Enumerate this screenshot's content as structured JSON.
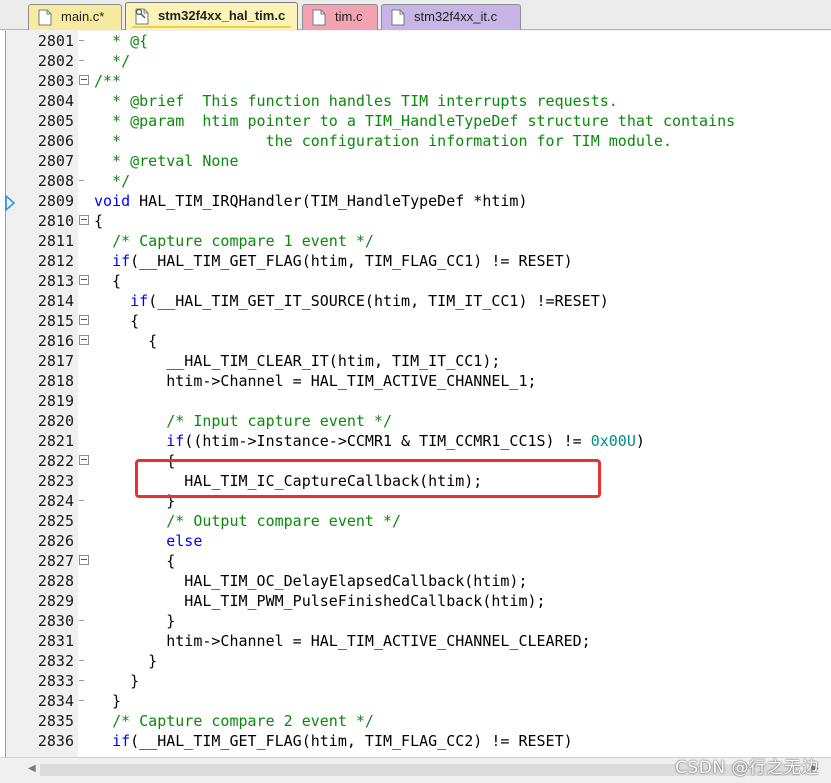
{
  "tabs": [
    {
      "label": "main.c*",
      "active": false,
      "color": "#f6eba0"
    },
    {
      "label": "stm32f4xx_hal_tim.c",
      "active": true,
      "color": "#fbf3b7"
    },
    {
      "label": "tim.c",
      "active": false,
      "color": "#f3a2b3"
    },
    {
      "label": "stm32f4xx_it.c",
      "active": false,
      "color": "#c7b5e8"
    }
  ],
  "editor": {
    "current_line": "2809",
    "highlighted_line": "2823",
    "lines": [
      {
        "n": "2801",
        "fold": "tick",
        "segments": [
          {
            "t": "  * @{",
            "c": "cm"
          }
        ]
      },
      {
        "n": "2802",
        "fold": "tick",
        "segments": [
          {
            "t": "  */",
            "c": "cm"
          }
        ]
      },
      {
        "n": "2803",
        "fold": "box",
        "segments": [
          {
            "t": "/**",
            "c": "cm"
          }
        ]
      },
      {
        "n": "2804",
        "fold": "",
        "segments": [
          {
            "t": "  * @brief  This function handles TIM interrupts requests.",
            "c": "cm"
          }
        ]
      },
      {
        "n": "2805",
        "fold": "",
        "segments": [
          {
            "t": "  * @param  htim pointer to a TIM_HandleTypeDef structure that contains",
            "c": "cm"
          }
        ]
      },
      {
        "n": "2806",
        "fold": "",
        "segments": [
          {
            "t": "  *                the configuration information for TIM module.",
            "c": "cm"
          }
        ]
      },
      {
        "n": "2807",
        "fold": "",
        "segments": [
          {
            "t": "  * @retval None",
            "c": "cm"
          }
        ]
      },
      {
        "n": "2808",
        "fold": "tick",
        "segments": [
          {
            "t": "  */",
            "c": "cm"
          }
        ]
      },
      {
        "n": "2809",
        "fold": "",
        "segments": [
          {
            "t": "void",
            "c": "kw"
          },
          {
            "t": " HAL_TIM_IRQHandler(TIM_HandleTypeDef *htim)",
            "c": ""
          }
        ]
      },
      {
        "n": "2810",
        "fold": "box",
        "segments": [
          {
            "t": "{",
            "c": ""
          }
        ]
      },
      {
        "n": "2811",
        "fold": "",
        "segments": [
          {
            "t": "  ",
            "c": ""
          },
          {
            "t": "/* Capture compare 1 event */",
            "c": "cm"
          }
        ]
      },
      {
        "n": "2812",
        "fold": "",
        "segments": [
          {
            "t": "  ",
            "c": ""
          },
          {
            "t": "if",
            "c": "kw"
          },
          {
            "t": "(__HAL_TIM_GET_FLAG(htim, TIM_FLAG_CC1) != RESET)",
            "c": ""
          }
        ]
      },
      {
        "n": "2813",
        "fold": "box",
        "segments": [
          {
            "t": "  {",
            "c": ""
          }
        ]
      },
      {
        "n": "2814",
        "fold": "",
        "segments": [
          {
            "t": "    ",
            "c": ""
          },
          {
            "t": "if",
            "c": "kw"
          },
          {
            "t": "(__HAL_TIM_GET_IT_SOURCE(htim, TIM_IT_CC1) !=RESET)",
            "c": ""
          }
        ]
      },
      {
        "n": "2815",
        "fold": "box",
        "segments": [
          {
            "t": "    {",
            "c": ""
          }
        ]
      },
      {
        "n": "2816",
        "fold": "box",
        "segments": [
          {
            "t": "      {",
            "c": ""
          }
        ]
      },
      {
        "n": "2817",
        "fold": "",
        "segments": [
          {
            "t": "        __HAL_TIM_CLEAR_IT(htim, TIM_IT_CC1);",
            "c": ""
          }
        ]
      },
      {
        "n": "2818",
        "fold": "",
        "segments": [
          {
            "t": "        htim->Channel = HAL_TIM_ACTIVE_CHANNEL_1;",
            "c": ""
          }
        ]
      },
      {
        "n": "2819",
        "fold": "",
        "segments": [
          {
            "t": "",
            "c": ""
          }
        ]
      },
      {
        "n": "2820",
        "fold": "",
        "segments": [
          {
            "t": "        ",
            "c": ""
          },
          {
            "t": "/* Input capture event */",
            "c": "cm"
          }
        ]
      },
      {
        "n": "2821",
        "fold": "",
        "segments": [
          {
            "t": "        ",
            "c": ""
          },
          {
            "t": "if",
            "c": "kw"
          },
          {
            "t": "((htim->Instance->CCMR1 & TIM_CCMR1_CC1S) != ",
            "c": ""
          },
          {
            "t": "0x00U",
            "c": "num"
          },
          {
            "t": ")",
            "c": ""
          }
        ]
      },
      {
        "n": "2822",
        "fold": "box",
        "segments": [
          {
            "t": "        {",
            "c": ""
          }
        ]
      },
      {
        "n": "2823",
        "fold": "",
        "segments": [
          {
            "t": "          HAL_TIM_IC_CaptureCallback(htim);",
            "c": ""
          }
        ]
      },
      {
        "n": "2824",
        "fold": "tick",
        "segments": [
          {
            "t": "        }",
            "c": ""
          }
        ]
      },
      {
        "n": "2825",
        "fold": "",
        "segments": [
          {
            "t": "        ",
            "c": ""
          },
          {
            "t": "/* Output compare event */",
            "c": "cm"
          }
        ]
      },
      {
        "n": "2826",
        "fold": "",
        "segments": [
          {
            "t": "        ",
            "c": ""
          },
          {
            "t": "else",
            "c": "kw"
          }
        ]
      },
      {
        "n": "2827",
        "fold": "box",
        "segments": [
          {
            "t": "        {",
            "c": ""
          }
        ]
      },
      {
        "n": "2828",
        "fold": "",
        "segments": [
          {
            "t": "          HAL_TIM_OC_DelayElapsedCallback(htim);",
            "c": ""
          }
        ]
      },
      {
        "n": "2829",
        "fold": "",
        "segments": [
          {
            "t": "          HAL_TIM_PWM_PulseFinishedCallback(htim);",
            "c": ""
          }
        ]
      },
      {
        "n": "2830",
        "fold": "tick",
        "segments": [
          {
            "t": "        }",
            "c": ""
          }
        ]
      },
      {
        "n": "2831",
        "fold": "",
        "segments": [
          {
            "t": "        htim->Channel = HAL_TIM_ACTIVE_CHANNEL_CLEARED;",
            "c": ""
          }
        ]
      },
      {
        "n": "2832",
        "fold": "tick",
        "segments": [
          {
            "t": "      }",
            "c": ""
          }
        ]
      },
      {
        "n": "2833",
        "fold": "tick",
        "segments": [
          {
            "t": "    }",
            "c": ""
          }
        ]
      },
      {
        "n": "2834",
        "fold": "tick",
        "segments": [
          {
            "t": "  }",
            "c": ""
          }
        ]
      },
      {
        "n": "2835",
        "fold": "",
        "segments": [
          {
            "t": "  ",
            "c": ""
          },
          {
            "t": "/* Capture compare 2 event */",
            "c": "cm"
          }
        ]
      },
      {
        "n": "2836",
        "fold": "",
        "segments": [
          {
            "t": "  ",
            "c": ""
          },
          {
            "t": "if",
            "c": "kw"
          },
          {
            "t": "(__HAL_TIM_GET_FLAG(htim, TIM_FLAG_CC2) != RESET)",
            "c": ""
          }
        ]
      }
    ]
  },
  "watermark": "CSDN @行之无边",
  "colors": {
    "comment": "#0a8a0a",
    "keyword": "#0000ff",
    "number": "#008c8c",
    "highlight_border": "#e53333",
    "gutter": "#f0f0f0"
  }
}
